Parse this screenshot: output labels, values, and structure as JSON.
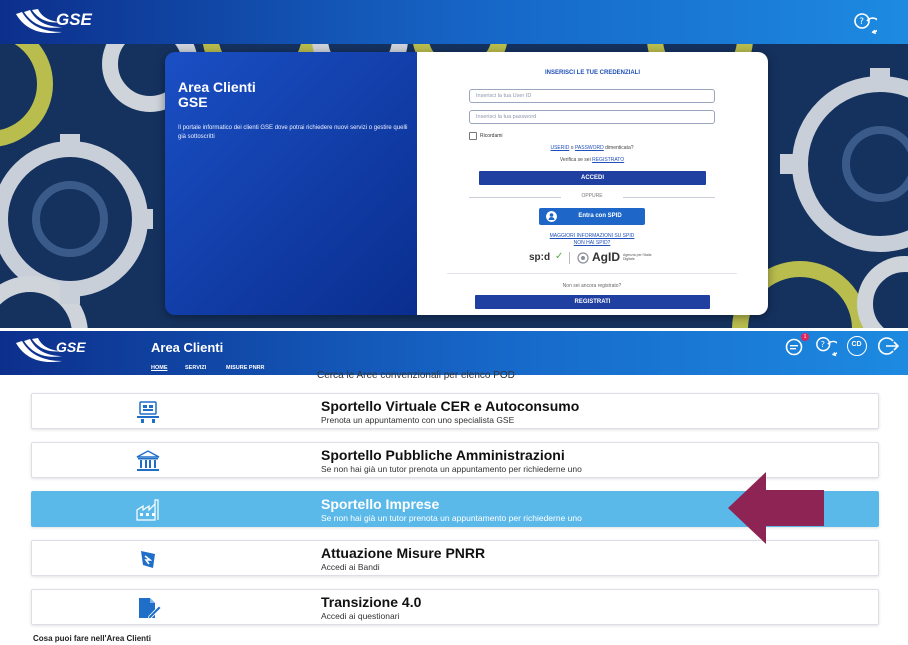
{
  "top_screen": {
    "logo_text": "GSE",
    "login": {
      "left_title_line1": "Area Clienti",
      "left_title_line2": "GSE",
      "left_description": "Il portale informatico dei clienti GSE dove potrai richiedere nuovi servizi o gestire quelli già sottoscritti",
      "form_title": "INSERISCI LE TUE CREDENZIALI",
      "userid_placeholder": "Inserisci la tua User ID",
      "password_placeholder": "Inserisci la tua password",
      "remember_label": "Ricordami",
      "forgot_userid": "USERID",
      "forgot_or": "o",
      "forgot_password": "PASSWORD",
      "forgot_suffix": "dimenticata?",
      "verify_prefix": "Verifica se sei",
      "verify_link": "REGISTRATO",
      "login_button": "ACCEDI",
      "or_label": "OPPURE",
      "spid_button": "Entra con SPID",
      "spid_info_link": "MAGGIORI INFORMAZIONI SU SPID",
      "no_spid_link": "NON HAI SPID?",
      "spid_logo_text": "sp:d",
      "agid_logo_text": "AgID",
      "agid_sub": "Agenzia per l'Italia Digitale",
      "not_registered": "Non sei ancora registrato?",
      "register_button": "REGISTRATI"
    }
  },
  "bottom_screen": {
    "header_title": "Area Clienti",
    "nav": [
      "HOME",
      "SERVIZI",
      "MISURE PNRR"
    ],
    "notification_count": "1",
    "cd_icon_label": "CD",
    "partial_text": "Cerca le Aree convenzionali per elenco POD",
    "cards": [
      {
        "title": "Sportello Virtuale CER e Autoconsumo",
        "subtitle": "Prenota un appuntamento con uno specialista GSE",
        "icon": "monitor-people-icon",
        "highlighted": false
      },
      {
        "title": "Sportello Pubbliche Amministrazioni",
        "subtitle": "Se non hai già un tutor prenota un appuntamento per richiederne uno",
        "icon": "government-building-icon",
        "highlighted": false
      },
      {
        "title": "Sportello Imprese",
        "subtitle": "Se non hai già un tutor prenota un appuntamento per richiederne uno",
        "icon": "factory-icon",
        "highlighted": true
      },
      {
        "title": "Attuazione Misure PNRR",
        "subtitle": "Accedi ai Bandi",
        "icon": "pnrr-logo-icon",
        "highlighted": false
      },
      {
        "title": "Transizione 4.0",
        "subtitle": "Accedi ai questionari",
        "icon": "document-pen-icon",
        "highlighted": false
      }
    ],
    "footer_heading": "Cosa puoi fare nell'Area Clienti"
  },
  "colors": {
    "header_gradient_start": "#0d2f8c",
    "header_gradient_end": "#1d8ae0",
    "highlight_card": "#5bb9ea",
    "arrow": "#8e2453",
    "primary_button": "#1f3fa1",
    "spid_button": "#1e67c8"
  }
}
